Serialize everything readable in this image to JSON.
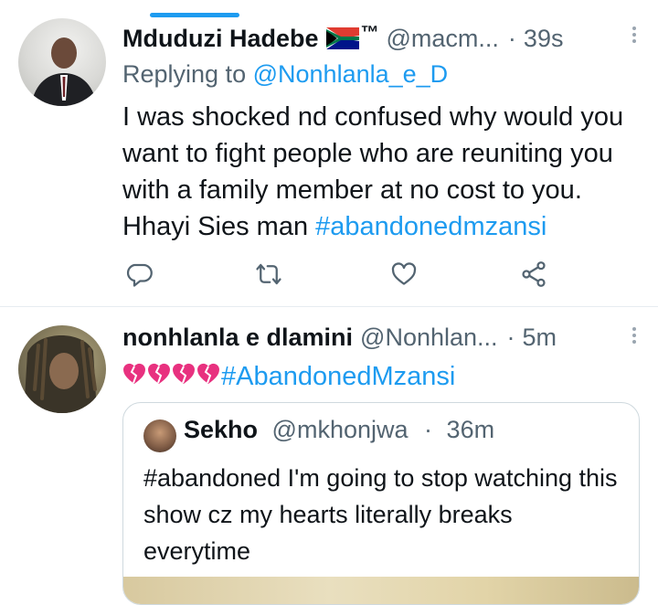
{
  "tweets": [
    {
      "name": "Mduduzi Hadebe",
      "tm": "™",
      "handle": "@macm...",
      "dot": "·",
      "time": "39s",
      "replying_prefix": "Replying to",
      "replying_to": "@Nonhlanla_e_D",
      "body": "I was shocked nd confused why would you want to fight people who are reuniting you with a family member at no cost to you. Hhayi Sies man",
      "hashtag": "#abandonedmzansi"
    },
    {
      "name": "nonhlanla e dlamini",
      "handle": "@Nonhlan...",
      "dot": "·",
      "time": "5m",
      "hashtag": "#AbandonedMzansi",
      "quote": {
        "name": "Sekho",
        "handle": "@mkhonjwa",
        "dot": "·",
        "time": "36m",
        "body": "#abandoned I'm going to stop watching this show cz my hearts literally breaks everytime"
      }
    }
  ],
  "icons": [
    "reply-icon",
    "retweet-icon",
    "like-icon",
    "share-icon",
    "more-icon",
    "south-africa-flag-icon",
    "broken-heart-icon"
  ],
  "colors": {
    "link": "#1d9bf0",
    "secondary_text": "#536471",
    "broken_heart": "#e8317f"
  }
}
